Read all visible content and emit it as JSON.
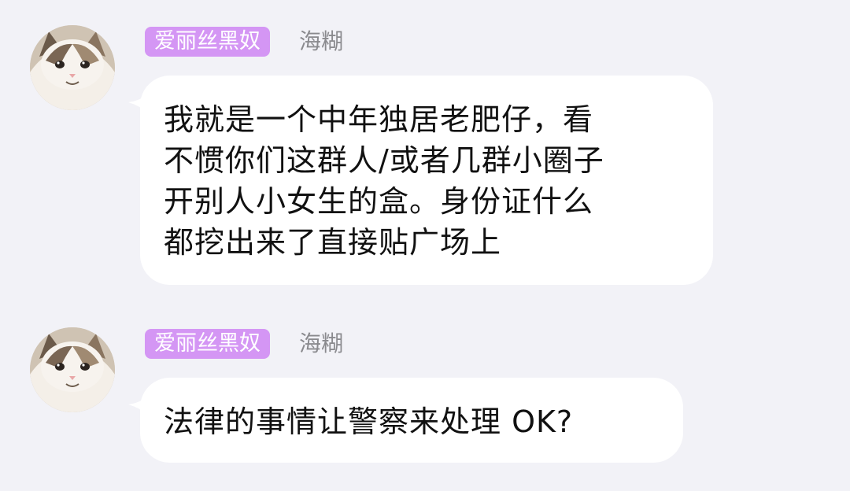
{
  "messages": [
    {
      "sender": {
        "badge": "爱丽丝黑奴",
        "nickname": "海糊"
      },
      "avatar": "cat-avatar-icon",
      "text": "我就是一个中年独居老肥仔，看\n不惯你们这群人/或者几群小圈子\n开别人小女生的盒。身份证什么\n都挖出来了直接贴广场上"
    },
    {
      "sender": {
        "badge": "爱丽丝黑奴",
        "nickname": "海糊"
      },
      "avatar": "cat-avatar-icon",
      "text": "法律的事情让警察来处理 OK?"
    }
  ],
  "colors": {
    "background": "#f2f2f7",
    "bubble": "#ffffff",
    "badge": "#d496f4",
    "nickname": "#8a8a8e",
    "text": "#111111"
  }
}
